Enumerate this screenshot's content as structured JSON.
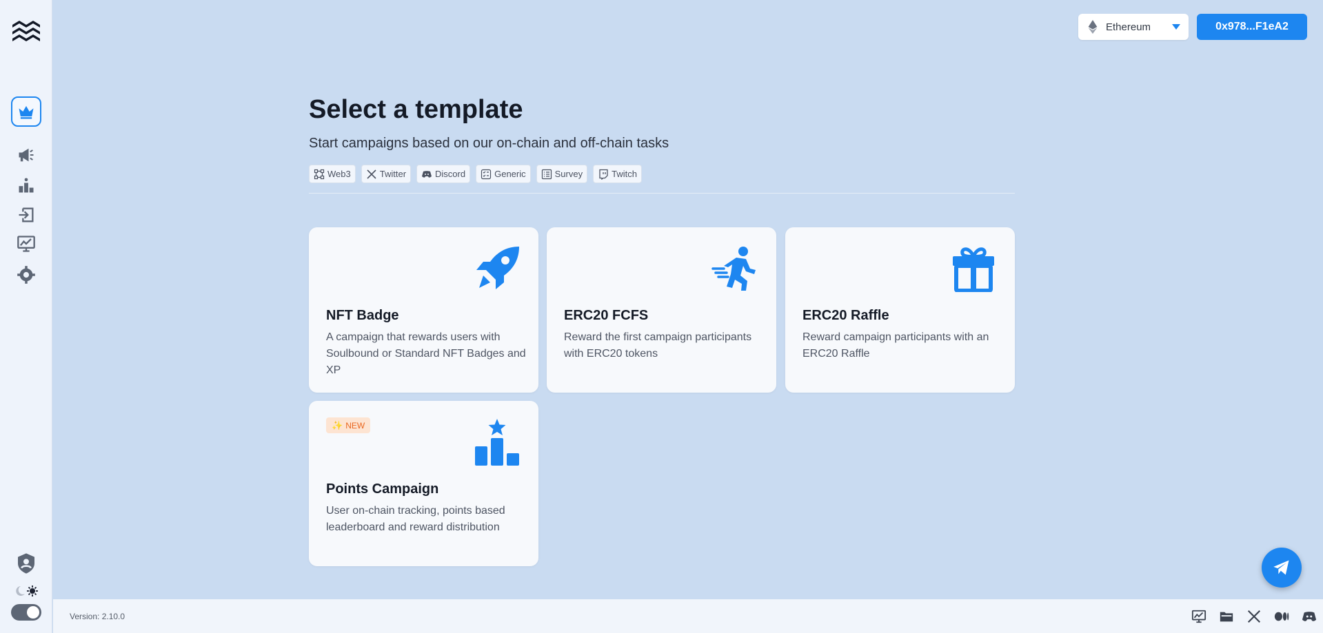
{
  "colors": {
    "accent": "#1d86f0",
    "background": "#c9dbf1",
    "sidebar": "#eef3fb",
    "card": "#f7f9fc",
    "new_badge_bg": "#fde4d2",
    "new_badge_text": "#e9661f"
  },
  "sidebar": {
    "logo_icon": "brand-logo-icon",
    "items": [
      {
        "icon": "crown-icon",
        "active": true
      },
      {
        "icon": "megaphone-icon",
        "active": false
      },
      {
        "icon": "leaderboard-icon",
        "active": false
      },
      {
        "icon": "login-icon",
        "active": false
      },
      {
        "icon": "analytics-icon",
        "active": false
      },
      {
        "icon": "gear-icon",
        "active": false
      }
    ],
    "profile_icon": "user-shield-icon",
    "theme_icons": [
      "moon-icon",
      "sun-icon"
    ]
  },
  "header": {
    "network": {
      "label": "Ethereum",
      "icon": "ethereum-icon"
    },
    "wallet_label": "0x978...F1eA2"
  },
  "main": {
    "title": "Select a template",
    "subtitle": "Start campaigns based on our on-chain and off-chain tasks",
    "filters": [
      {
        "label": "Web3",
        "icon": "web3-icon"
      },
      {
        "label": "Twitter",
        "icon": "x-icon"
      },
      {
        "label": "Discord",
        "icon": "discord-icon"
      },
      {
        "label": "Generic",
        "icon": "checklist-icon"
      },
      {
        "label": "Survey",
        "icon": "survey-icon"
      },
      {
        "label": "Twitch",
        "icon": "twitch-icon"
      }
    ],
    "cards": [
      {
        "title": "NFT Badge",
        "description": "A campaign that rewards users with Soulbound or Standard NFT Badges and XP",
        "icon": "rocket-icon"
      },
      {
        "title": "ERC20 FCFS",
        "description": "Reward the first campaign participants with ERC20 tokens",
        "icon": "running-person-icon"
      },
      {
        "title": "ERC20 Raffle",
        "description": "Reward campaign participants with an ERC20 Raffle",
        "icon": "gift-icon"
      },
      {
        "title": "Points Campaign",
        "description": "User on-chain tracking, points based leaderboard and reward distribution",
        "icon": "podium-star-icon",
        "badge": "NEW"
      }
    ]
  },
  "footer": {
    "version": "Version: 2.10.0",
    "icons": [
      "analytics-icon",
      "folder-icon",
      "x-icon",
      "medium-icon",
      "discord-icon"
    ]
  },
  "fab_icon": "telegram-icon"
}
